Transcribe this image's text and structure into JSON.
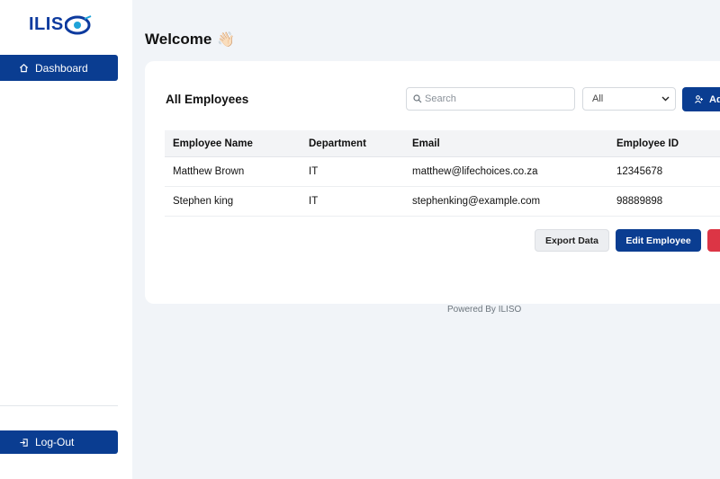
{
  "brand": {
    "logo_text": "ILIS"
  },
  "sidebar": {
    "dashboard_label": "Dashboard",
    "logout_label": "Log-Out"
  },
  "header": {
    "welcome": "Welcome",
    "wave_emoji": "👋🏻"
  },
  "employees": {
    "title": "All Employees",
    "search_placeholder": "Search",
    "filter_selected": "All",
    "add_label": "Ad",
    "columns": [
      "Employee Name",
      "Department",
      "Email",
      "Employee ID"
    ],
    "rows": [
      [
        "Matthew Brown",
        "IT",
        "matthew@lifechoices.co.za",
        "12345678"
      ],
      [
        "Stephen king",
        "IT",
        "stephenking@example.com",
        "98889898"
      ]
    ],
    "export_label": "Export Data",
    "edit_label": "Edit Employee"
  },
  "footer": {
    "text": "Powered By ILISO"
  },
  "colors": {
    "primary": "#0a3d91",
    "danger": "#dc3545",
    "background": "#f1f4f8"
  }
}
